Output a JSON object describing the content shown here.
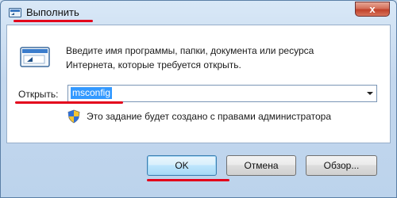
{
  "window": {
    "title": "Выполнить",
    "title_icon": "run-dialog-icon",
    "close_symbol": "x"
  },
  "main": {
    "icon": "run-dialog-icon",
    "description_line1": "Введите имя программы, папки, документа или ресурса",
    "description_line2": "Интернета, которые требуется открыть.",
    "open_label": "Открыть:",
    "open_value": "msconfig",
    "admin_icon": "uac-shield-icon",
    "admin_note": "Это задание будет создано с правами администратора"
  },
  "buttons": {
    "ok": "OK",
    "cancel": "Отмена",
    "browse": "Обзор..."
  },
  "annotations": {
    "underline_color": "#e3001b"
  }
}
